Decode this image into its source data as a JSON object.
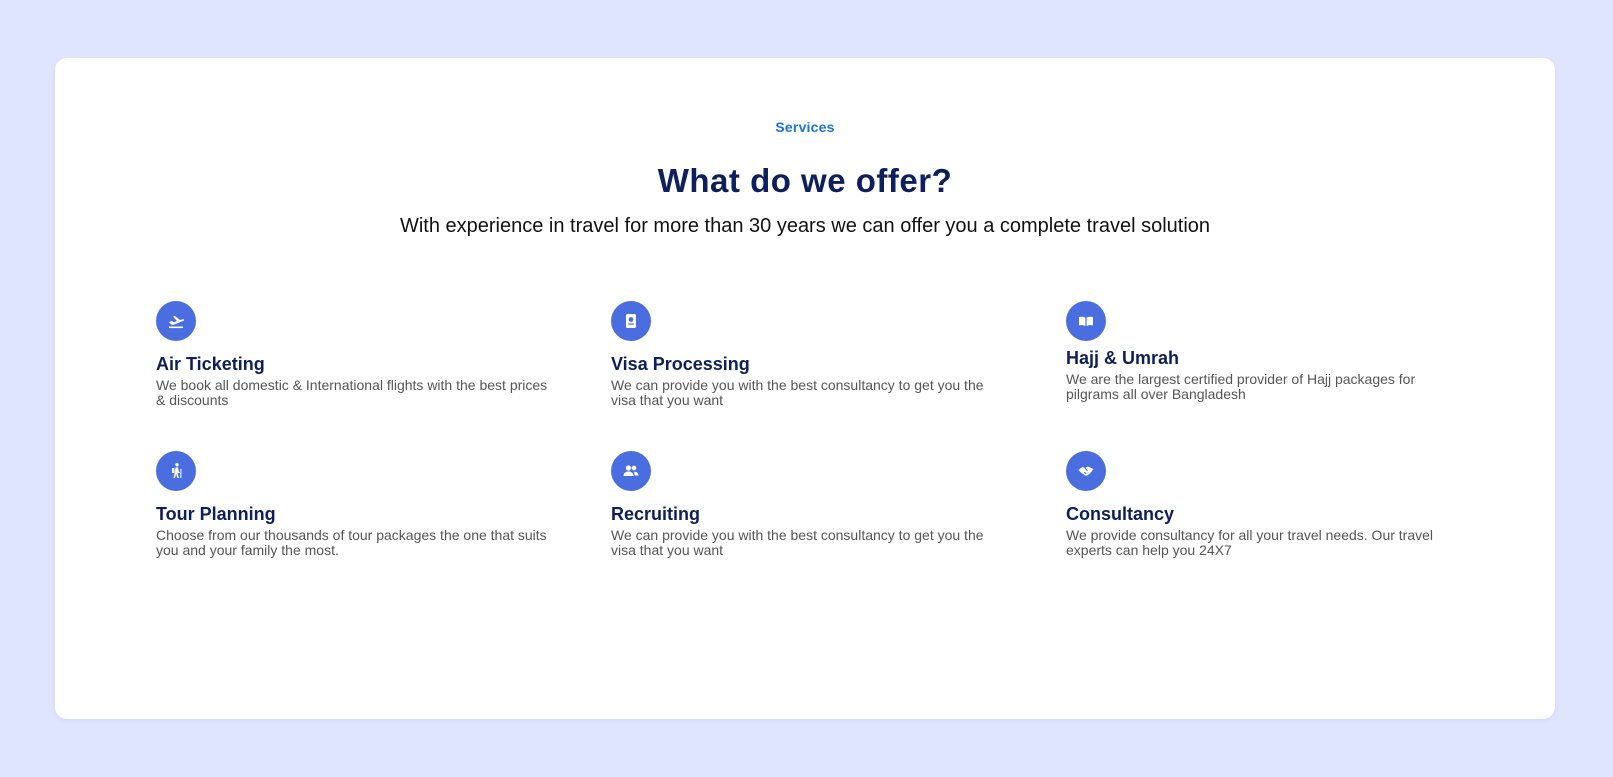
{
  "section": {
    "eyebrow": "Services",
    "title": "What do we offer?",
    "subtitle": "With experience in travel for more than 30 years we can offer you a complete travel solution"
  },
  "colors": {
    "page_bg": "#e0e5ff",
    "accent_blue": "#1a73e8",
    "icon_bg": "#4a6ee0",
    "heading_navy": "#0d1f5c"
  },
  "services": [
    {
      "icon": "plane-departure-icon",
      "title": "Air Ticketing",
      "description": "We book all domestic & International flights with the best prices & discounts"
    },
    {
      "icon": "passport-icon",
      "title": "Visa Processing",
      "description": "We can provide you with the best consultancy to get you the visa that you want"
    },
    {
      "icon": "book-open-icon",
      "title": "Hajj & Umrah",
      "description": "We are the largest certified provider of Hajj packages for pilgrams all over Bangladesh"
    },
    {
      "icon": "hiking-icon",
      "title": "Tour Planning",
      "description": "Choose from our thousands of tour packages the one that suits you and your family the most."
    },
    {
      "icon": "users-icon",
      "title": "Recruiting",
      "description": "We can provide you with the best consultancy to get you the visa that you want"
    },
    {
      "icon": "handshake-icon",
      "title": "Consultancy",
      "description": "We provide consultancy for all your travel needs. Our travel experts can help you 24X7"
    }
  ]
}
